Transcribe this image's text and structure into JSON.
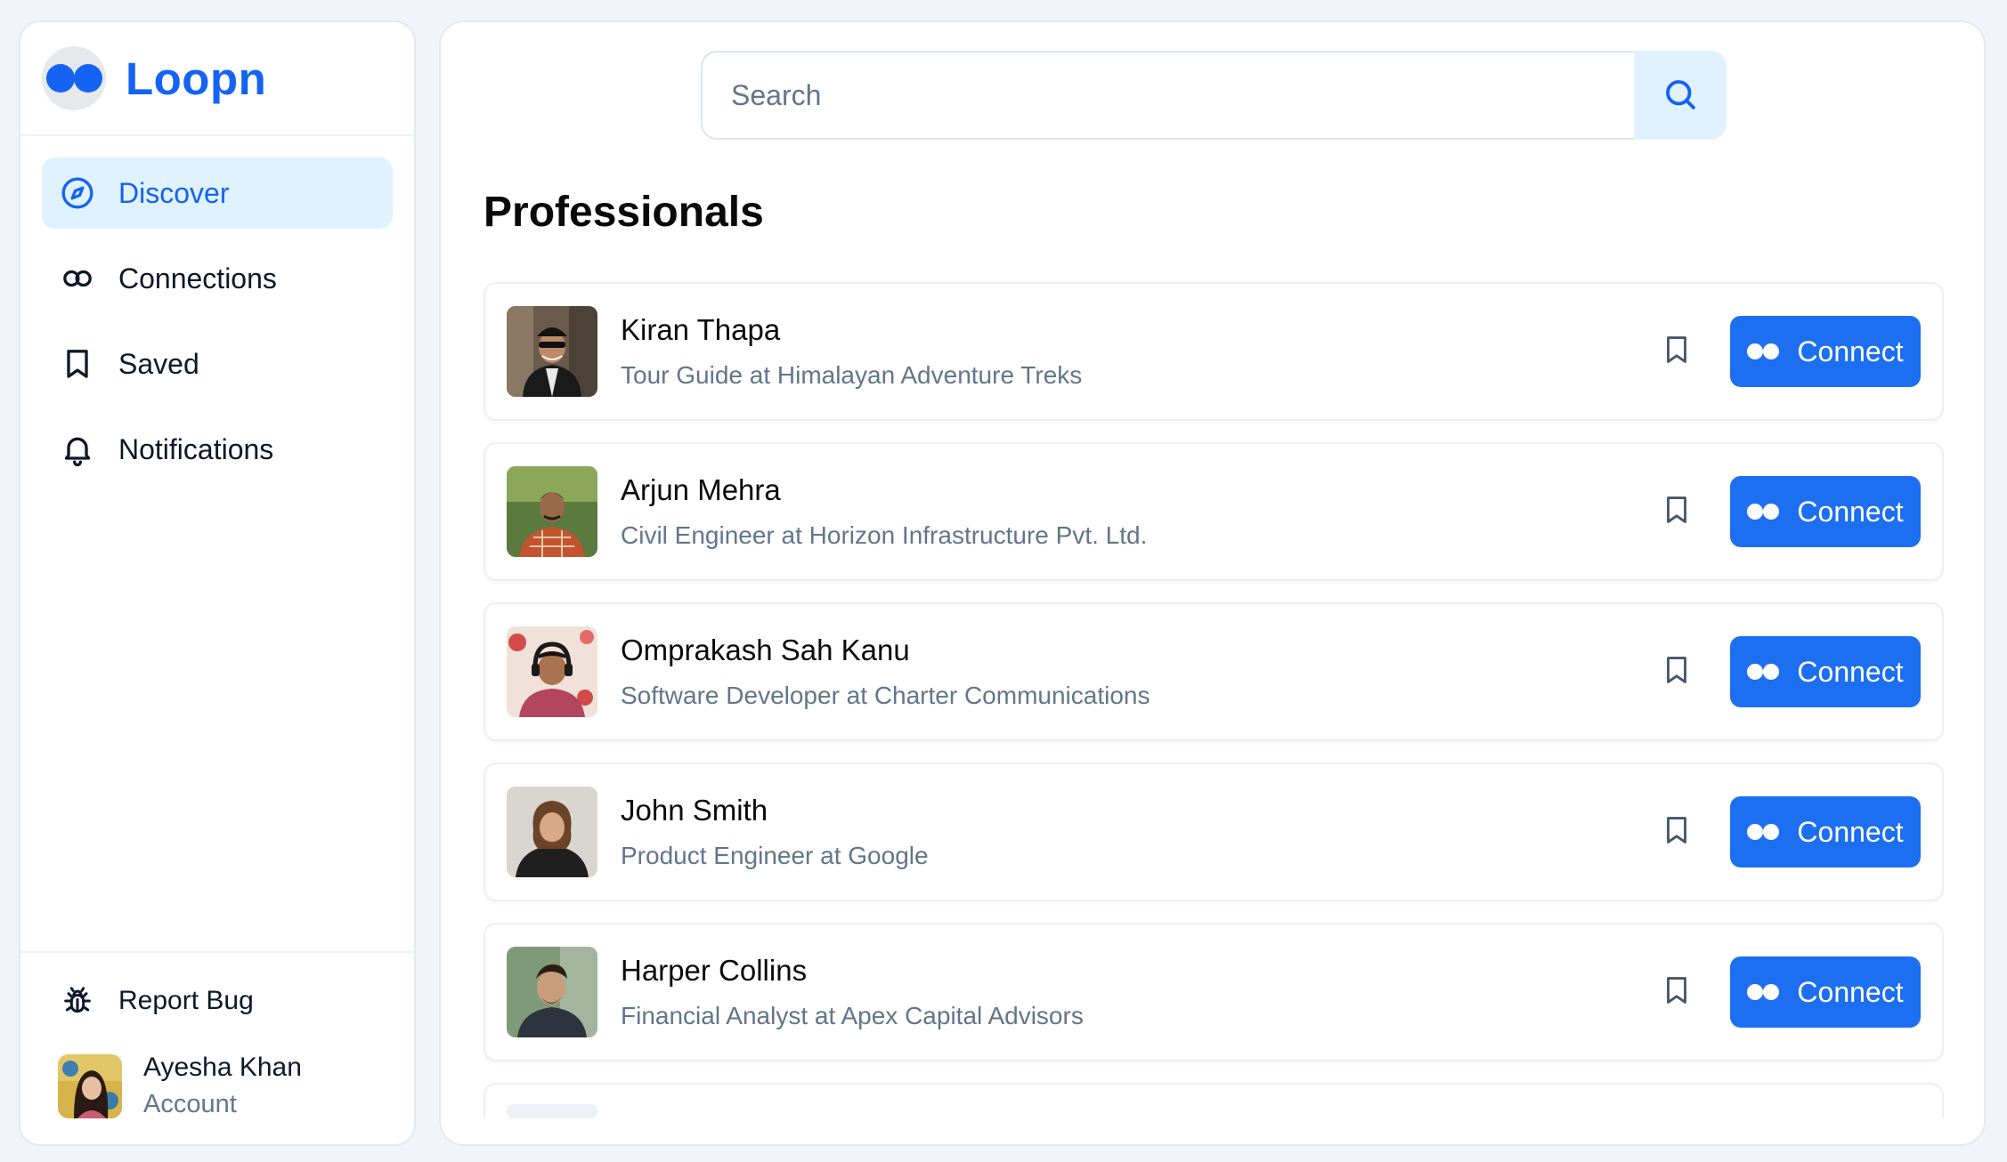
{
  "app": {
    "name": "Loopn",
    "accent_color": "#1463f3",
    "active_nav_bg": "#e0f2fe"
  },
  "sidebar": {
    "items": [
      {
        "label": "Discover",
        "icon": "compass-icon",
        "active": true
      },
      {
        "label": "Connections",
        "icon": "infinity-icon",
        "active": false
      },
      {
        "label": "Saved",
        "icon": "bookmark-icon",
        "active": false
      },
      {
        "label": "Notifications",
        "icon": "bell-icon",
        "active": false
      }
    ],
    "report_bug": {
      "label": "Report Bug",
      "icon": "bug-icon"
    },
    "account": {
      "name": "Ayesha Khan",
      "subtitle": "Account",
      "avatar": "user-avatar"
    }
  },
  "search": {
    "placeholder": "Search",
    "value": "",
    "icon": "search-icon"
  },
  "main": {
    "section_title": "Professionals",
    "connect_label": "Connect",
    "professionals": [
      {
        "name": "Kiran Thapa",
        "title": "Tour Guide at Himalayan Adventure Treks"
      },
      {
        "name": "Arjun Mehra",
        "title": "Civil Engineer at Horizon Infrastructure Pvt. Ltd."
      },
      {
        "name": "Omprakash Sah Kanu",
        "title": "Software Developer at Charter Communications"
      },
      {
        "name": "John Smith",
        "title": "Product Engineer at Google"
      },
      {
        "name": "Harper Collins",
        "title": "Financial Analyst at Apex Capital Advisors"
      }
    ]
  }
}
